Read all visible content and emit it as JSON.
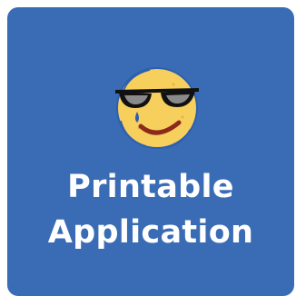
{
  "tile": {
    "title_line1": "Printable",
    "title_line2": "Application",
    "icon": "cool-sunglasses-face-icon",
    "background_color": "#3a6cb5",
    "text_color": "#ffffff"
  }
}
